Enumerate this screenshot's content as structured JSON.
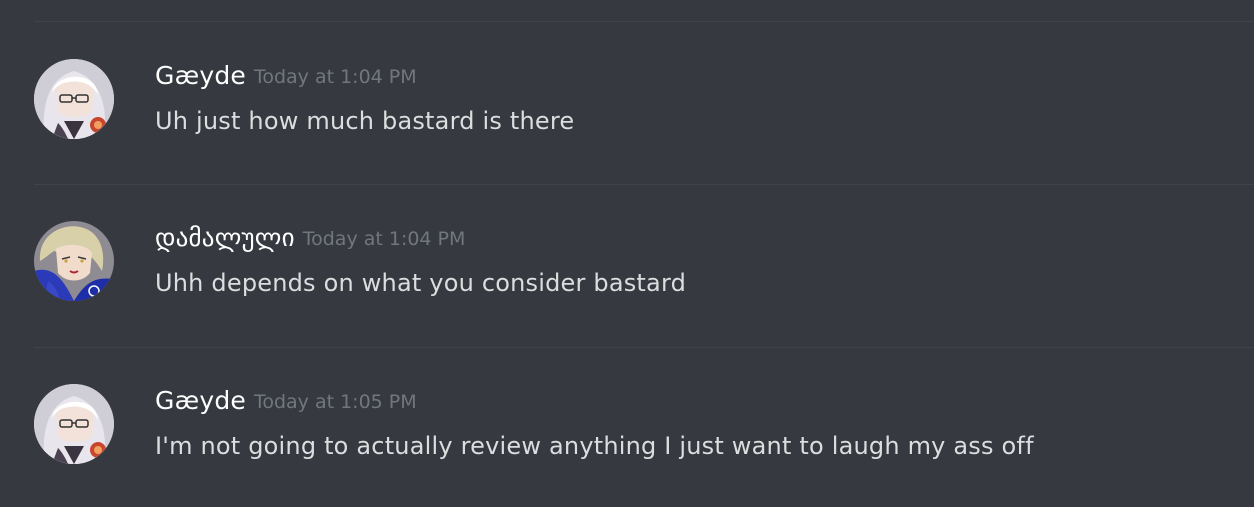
{
  "colors": {
    "background": "#36393f",
    "divider": "#40434a",
    "username": "#ffffff",
    "timestamp": "#72767d",
    "message_text": "#dcddde"
  },
  "messages": [
    {
      "author": "Gæyde",
      "timestamp": "Today at 1:04 PM",
      "text": "Uh just how much bastard is there",
      "avatar": "gaeyde-avatar"
    },
    {
      "author": "დამალული",
      "timestamp": "Today at 1:04 PM",
      "text": "Uhh depends on what you consider bastard",
      "avatar": "blonde-character-avatar"
    },
    {
      "author": "Gæyde",
      "timestamp": "Today at 1:05 PM",
      "text": "I'm not going to actually review anything I just want to laugh my ass off",
      "avatar": "gaeyde-avatar"
    }
  ]
}
